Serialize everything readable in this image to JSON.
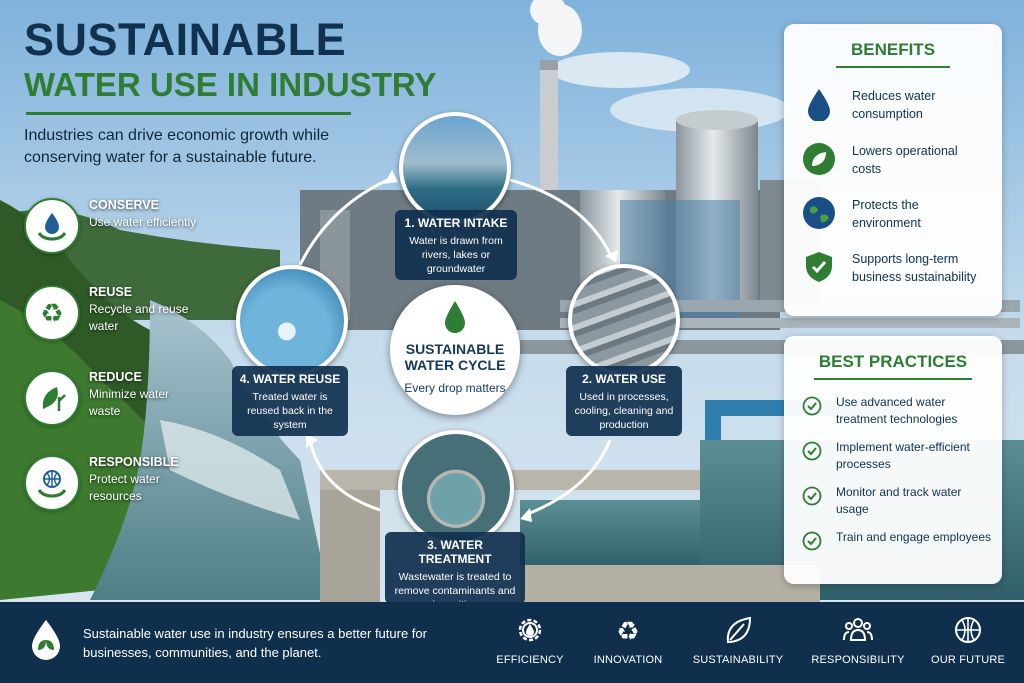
{
  "header": {
    "title_line1": "SUSTAINABLE",
    "title_line2": "WATER USE IN INDUSTRY",
    "intro": "Industries can drive economic growth while conserving water for a sustainable future."
  },
  "principles": [
    {
      "title": "CONSERVE",
      "desc": "Use water efficiently",
      "icon": "water-drop-hands-icon"
    },
    {
      "title": "REUSE",
      "desc": "Recycle and reuse water",
      "icon": "recycle-icon"
    },
    {
      "title": "REDUCE",
      "desc": "Minimize water waste",
      "icon": "leaf-plant-icon"
    },
    {
      "title": "RESPONSIBLE",
      "desc": "Protect water resources",
      "icon": "globe-hands-icon"
    }
  ],
  "cycle": {
    "center_title": "SUSTAINABLE WATER CYCLE",
    "center_subtitle": "Every drop matters",
    "steps": [
      {
        "title": "1. WATER INTAKE",
        "desc": "Water is drawn from rivers, lakes or groundwater"
      },
      {
        "title": "2. WATER USE",
        "desc": "Used in processes, cooling, cleaning and production"
      },
      {
        "title": "3. WATER TREATMENT",
        "desc": "Wastewater is treated to remove contaminants and impurities"
      },
      {
        "title": "4. WATER REUSE",
        "desc": "Treated water is reused back in the system"
      }
    ]
  },
  "benefits": {
    "heading": "BENEFITS",
    "items": [
      {
        "text": "Reduces water consumption",
        "icon": "water-drop-icon"
      },
      {
        "text": "Lowers operational costs",
        "icon": "leaf-cost-icon"
      },
      {
        "text": "Protects the environment",
        "icon": "globe-icon"
      },
      {
        "text": "Supports long-term business sustainability",
        "icon": "shield-check-icon"
      }
    ]
  },
  "practices": {
    "heading": "BEST PRACTICES",
    "items": [
      "Use advanced water treatment technologies",
      "Implement water-efficient processes",
      "Monitor and track water usage",
      "Train and engage employees"
    ]
  },
  "footer": {
    "text": "Sustainable water use in industry ensures a better future for businesses, communities, and the planet.",
    "items": [
      {
        "label": "EFFICIENCY",
        "icon": "gear-drop-icon"
      },
      {
        "label": "INNOVATION",
        "icon": "recycle-icon"
      },
      {
        "label": "SUSTAINABILITY",
        "icon": "leaf-icon"
      },
      {
        "label": "RESPONSIBILITY",
        "icon": "people-icon"
      },
      {
        "label": "OUR FUTURE",
        "icon": "globe-icon"
      }
    ]
  },
  "colors": {
    "navy": "#10324f",
    "green": "#2e7d32",
    "footer_bg": "#0f2f4d",
    "step_box": "#10304e"
  }
}
